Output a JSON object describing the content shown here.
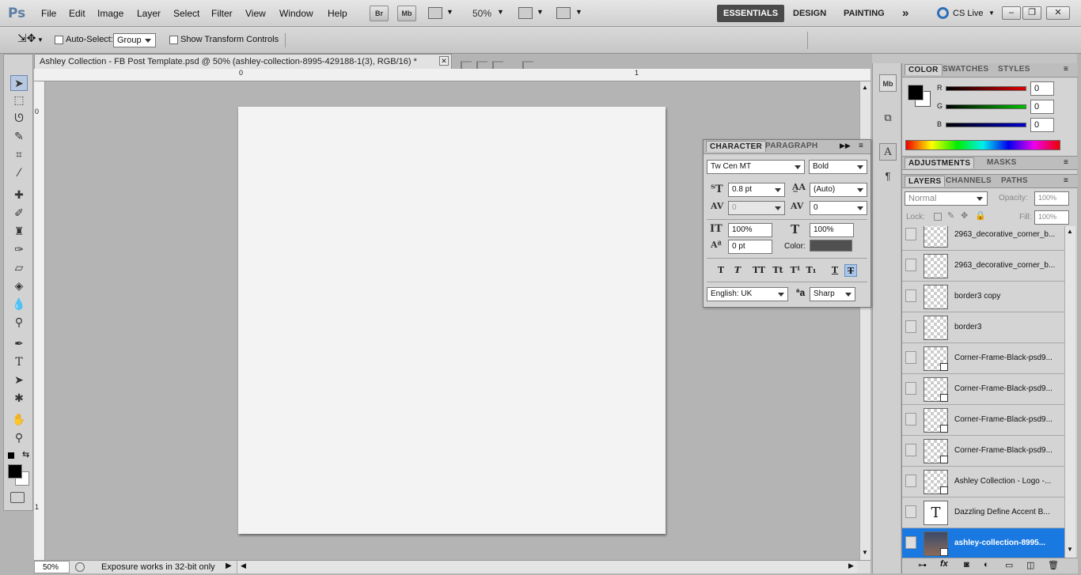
{
  "app": {
    "logo": "Ps",
    "menu": [
      "File",
      "Edit",
      "Image",
      "Layer",
      "Select",
      "Filter",
      "View",
      "Window",
      "Help"
    ],
    "bridge_label": "Br",
    "minibridge_label": "Mb",
    "zoom_menu": "50%",
    "workspaces": [
      "ESSENTIALS",
      "DESIGN",
      "PAINTING"
    ],
    "more_workspaces": "»",
    "cs_live": "CS Live"
  },
  "options": {
    "auto_select_label": "Auto-Select:",
    "auto_select_value": "Group",
    "show_transform_label": "Show Transform Controls"
  },
  "document": {
    "tab_title": "Ashley Collection - FB Post Template.psd @ 50%  (ashley-collection-8995-429188-1(3), RGB/16) *",
    "ruler_top": [
      "0",
      "1"
    ],
    "ruler_left": [
      "0",
      "1"
    ],
    "zoom": "50%",
    "status": "Exposure works in 32-bit only"
  },
  "color_panel": {
    "tabs": [
      "COLOR",
      "SWATCHES",
      "STYLES"
    ],
    "channels": [
      {
        "label": "R",
        "value": "0",
        "color": "#e00000"
      },
      {
        "label": "G",
        "value": "0",
        "color": "#00c000"
      },
      {
        "label": "B",
        "value": "0",
        "color": "#0000d0"
      }
    ]
  },
  "adjustments_panel": {
    "tabs": [
      "ADJUSTMENTS",
      "MASKS"
    ]
  },
  "layers_panel": {
    "tabs": [
      "LAYERS",
      "CHANNELS",
      "PATHS"
    ],
    "blend_mode": "Normal",
    "opacity_label": "Opacity:",
    "opacity_value": "100%",
    "lock_label": "Lock:",
    "fill_label": "Fill:",
    "fill_value": "100%",
    "layers": [
      {
        "name": "2963_decorative_corner_b...",
        "type": "raster"
      },
      {
        "name": "2963_decorative_corner_b...",
        "type": "raster"
      },
      {
        "name": "border3 copy",
        "type": "raster"
      },
      {
        "name": "border3",
        "type": "raster"
      },
      {
        "name": "Corner-Frame-Black-psd9...",
        "type": "smart"
      },
      {
        "name": "Corner-Frame-Black-psd9...",
        "type": "smart"
      },
      {
        "name": "Corner-Frame-Black-psd9...",
        "type": "smart"
      },
      {
        "name": "Corner-Frame-Black-psd9...",
        "type": "smart"
      },
      {
        "name": "Ashley Collection - Logo -...",
        "type": "smart"
      },
      {
        "name": "Dazzling Define  Accent B...",
        "type": "text"
      },
      {
        "name": "ashley-collection-8995...",
        "type": "photo",
        "selected": true
      }
    ]
  },
  "character_panel": {
    "tabs": [
      "CHARACTER",
      "PARAGRAPH"
    ],
    "font_family": "Tw Cen MT",
    "font_style": "Bold",
    "font_size": "0.8 pt",
    "leading": "(Auto)",
    "kerning": "0",
    "tracking": "0",
    "vertical_scale": "100%",
    "horizontal_scale": "100%",
    "baseline_shift": "0 pt",
    "color_label": "Color:",
    "text_color": "#505050",
    "style_buttons": [
      "T",
      "T",
      "TT",
      "Tt",
      "T¹",
      "T₁",
      "T",
      "T"
    ],
    "language": "English: UK",
    "antialias_icon": "ªa",
    "antialias": "Sharp"
  }
}
